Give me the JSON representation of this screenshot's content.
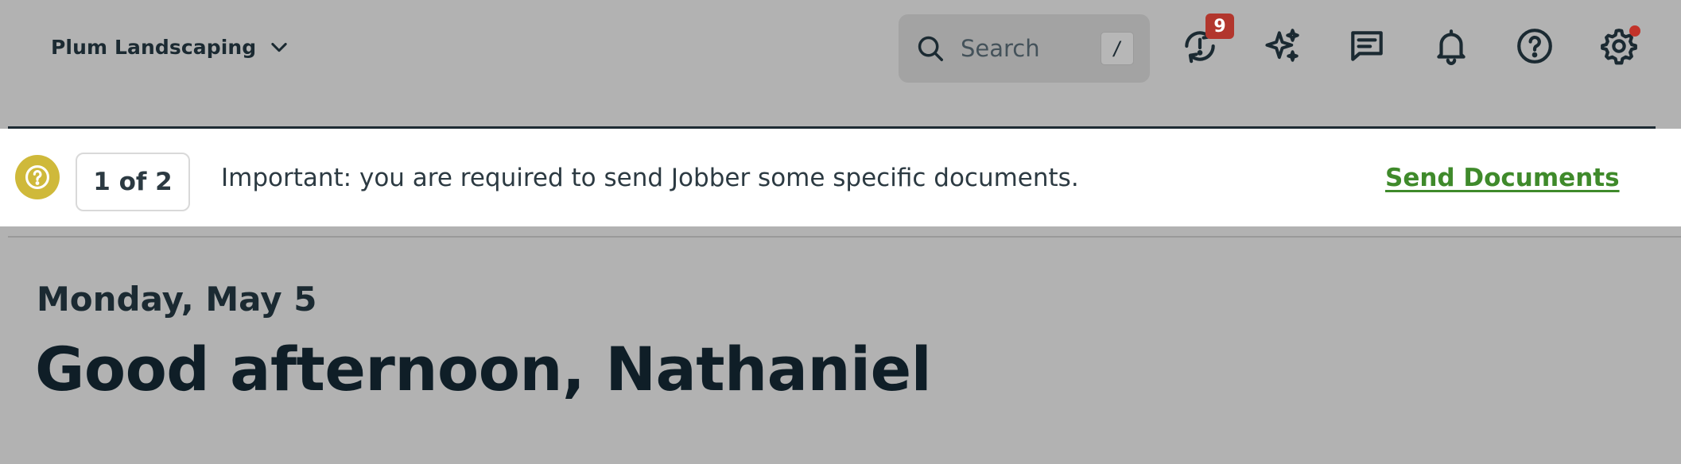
{
  "header": {
    "account_name": "Plum Landscaping",
    "search": {
      "placeholder": "Search",
      "shortcut_key": "/"
    },
    "icons": {
      "sync_requests": {
        "icon": "sync-alert-icon",
        "badge_count": "9"
      },
      "ai_assistant": {
        "icon": "sparkle-icon"
      },
      "messages": {
        "icon": "message-icon"
      },
      "notifications": {
        "icon": "bell-icon"
      },
      "help": {
        "icon": "help-circle-icon"
      },
      "settings": {
        "icon": "gear-icon",
        "has_alert_dot": true
      }
    }
  },
  "banner": {
    "pager_text": "1 of 2",
    "message": "Important: you are required to send Jobber some specific documents.",
    "action_label": "Send Documents"
  },
  "greeting": {
    "date": "Monday, May 5",
    "title": "Good afternoon, Nathaniel"
  },
  "colors": {
    "overlay_gray": "#b2b2b2",
    "text_dark": "#1b2a32",
    "badge_red": "#b2362d",
    "banner_help_yellow": "#cfb93a",
    "action_green": "#3f8a2b"
  }
}
